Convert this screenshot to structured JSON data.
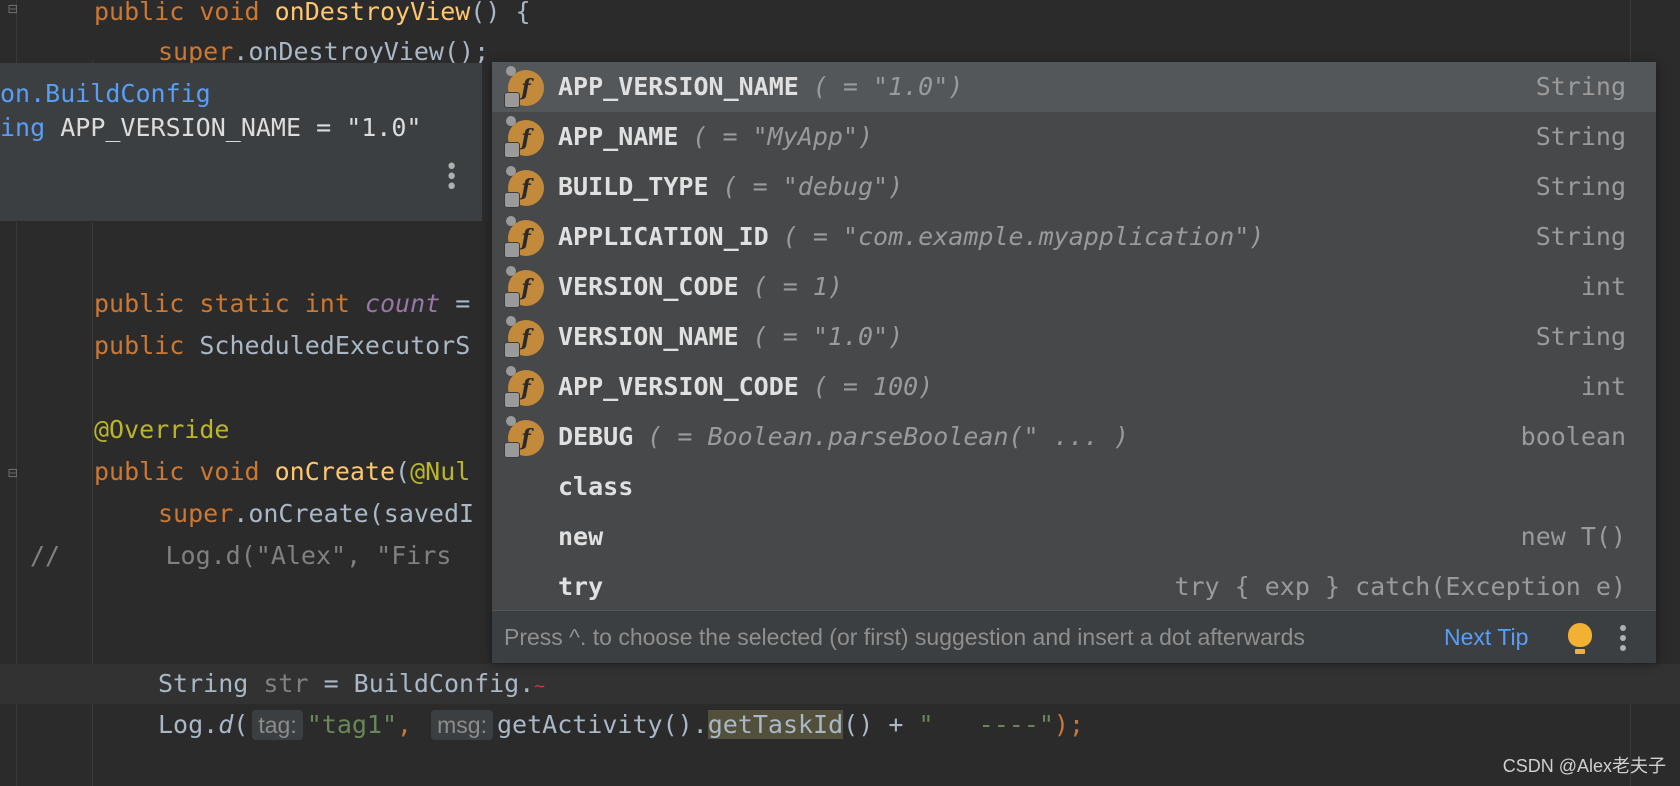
{
  "editor": {
    "lines": {
      "l1": {
        "kw": "public void ",
        "fn": "onDestroyView",
        "rest": "() {"
      },
      "l2": {
        "kw": "super",
        "rest": ".onDestroyView();"
      },
      "l3": {
        "kw1": "public static int ",
        "field": "count",
        "rest": " ="
      },
      "l4": {
        "kw": "public ",
        "rest": "ScheduledExecutorS"
      },
      "l5": {
        "ann": "@Override"
      },
      "l6": {
        "kw": "public void ",
        "fn": "onCreate",
        "rest": "(",
        "ann": "@Nul"
      },
      "l7": {
        "kw": "super",
        "rest": ".onCreate(savedI"
      },
      "l8": {
        "comment": "//       Log.d(\"Alex\", \"Firs"
      },
      "l9": {
        "type": "String ",
        "var": "str",
        "rest": " = BuildConfig."
      },
      "l10": {
        "pre": "Log.",
        "method": "d",
        "paren": "(",
        "hint1": "tag:",
        "str1": "\"tag1\"",
        "comma": ", ",
        "hint2": "msg:",
        "call": "getActivity().",
        "usage": "getTaskId",
        "post": "() + ",
        "str2": "\"   ----\"",
        "end": ");"
      }
    }
  },
  "doc_popup": {
    "line1": "on.BuildConfig",
    "line2_kw": "ing ",
    "line2_text": "APP_VERSION_NAME = \"1.0\"",
    "menu_icon": "vertical-dots-icon"
  },
  "completion": {
    "items": [
      {
        "name": "APP_VERSION_NAME",
        "detail": "( = \"1.0\")",
        "type": "String"
      },
      {
        "name": "APP_NAME",
        "detail": "( = \"MyApp\")",
        "type": "String"
      },
      {
        "name": "BUILD_TYPE",
        "detail": "( = \"debug\")",
        "type": "String"
      },
      {
        "name": "APPLICATION_ID",
        "detail": "( = \"com.example.myapplication\")",
        "type": "String"
      },
      {
        "name": "VERSION_CODE",
        "detail": "( = 1)",
        "type": "int"
      },
      {
        "name": "VERSION_NAME",
        "detail": "( = \"1.0\")",
        "type": "String"
      },
      {
        "name": "APP_VERSION_CODE",
        "detail": "( = 100)",
        "type": "int"
      },
      {
        "name": "DEBUG",
        "detail": "( = Boolean.parseBoolean(\" ... )",
        "type": "boolean"
      },
      {
        "name": "class",
        "detail": "",
        "type": ""
      },
      {
        "name": "new",
        "detail": "",
        "type": "new T()"
      },
      {
        "name": "try",
        "detail": "",
        "type": "try { exp } catch(Exception e)"
      }
    ],
    "field_icon_letter": "f",
    "footer_text": "Press ^. to choose the selected (or first) suggestion and insert a dot afterwards",
    "next_tip": "Next Tip",
    "bulb_icon": "lightbulb-icon",
    "menu_icon": "vertical-dots-icon"
  },
  "watermark": "CSDN @Alex老夫子"
}
